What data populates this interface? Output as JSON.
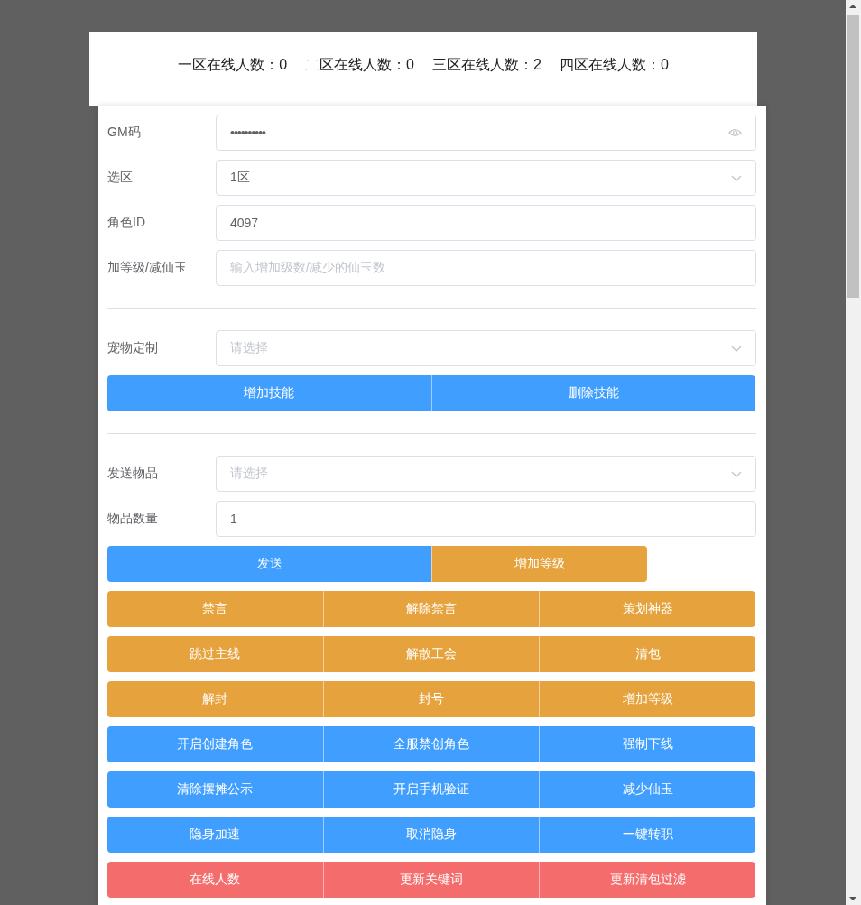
{
  "online_counts": [
    "一区在线人数：0",
    "二区在线人数：0",
    "三区在线人数：2",
    "四区在线人数：0"
  ],
  "sections": [
    {
      "fields": [
        {
          "label": "GM码",
          "kind": "password",
          "value": "••••••••••"
        },
        {
          "label": "选区",
          "kind": "select",
          "value": "1区"
        },
        {
          "label": "角色ID",
          "kind": "text",
          "value": "4097"
        },
        {
          "label": "加等级/减仙玉",
          "kind": "text",
          "placeholder": "输入增加级数/减少的仙玉数"
        }
      ]
    },
    {
      "fields": [
        {
          "label": "宠物定制",
          "kind": "select",
          "placeholder": "请选择"
        }
      ],
      "button_groups": [
        {
          "kind": "even",
          "buttons": [
            {
              "label": "增加技能",
              "color": "#409eff"
            },
            {
              "label": "删除技能",
              "color": "#409eff"
            }
          ]
        }
      ]
    },
    {
      "fields": [
        {
          "label": "发送物品",
          "kind": "select",
          "placeholder": "请选择"
        },
        {
          "label": "物品数量",
          "kind": "text",
          "value": "1"
        }
      ],
      "button_groups": [
        {
          "kind": "split",
          "buttons": [
            {
              "label": "发送",
              "color": "#409eff"
            },
            {
              "label": "增加等级",
              "color": "#e6a23c"
            }
          ]
        },
        {
          "kind": "even",
          "buttons": [
            {
              "label": "禁言",
              "color": "#e6a23c"
            },
            {
              "label": "解除禁言",
              "color": "#e6a23c"
            },
            {
              "label": "策划神器",
              "color": "#e6a23c"
            }
          ]
        },
        {
          "kind": "even",
          "buttons": [
            {
              "label": "跳过主线",
              "color": "#e6a23c"
            },
            {
              "label": "解散工会",
              "color": "#e6a23c"
            },
            {
              "label": "清包",
              "color": "#e6a23c"
            }
          ]
        },
        {
          "kind": "even",
          "buttons": [
            {
              "label": "解封",
              "color": "#e6a23c"
            },
            {
              "label": "封号",
              "color": "#e6a23c"
            },
            {
              "label": "增加等级",
              "color": "#e6a23c"
            }
          ]
        },
        {
          "kind": "even",
          "buttons": [
            {
              "label": "开启创建角色",
              "color": "#409eff"
            },
            {
              "label": "全服禁创角色",
              "color": "#409eff"
            },
            {
              "label": "强制下线",
              "color": "#409eff"
            }
          ]
        },
        {
          "kind": "even",
          "buttons": [
            {
              "label": "清除摆摊公示",
              "color": "#409eff"
            },
            {
              "label": "开启手机验证",
              "color": "#409eff"
            },
            {
              "label": "减少仙玉",
              "color": "#409eff"
            }
          ]
        },
        {
          "kind": "even",
          "buttons": [
            {
              "label": "隐身加速",
              "color": "#409eff"
            },
            {
              "label": "取消隐身",
              "color": "#409eff"
            },
            {
              "label": "一键转职",
              "color": "#409eff"
            }
          ]
        },
        {
          "kind": "even",
          "buttons": [
            {
              "label": "在线人数",
              "color": "#f56c6c"
            },
            {
              "label": "更新关键词",
              "color": "#f56c6c"
            },
            {
              "label": "更新清包过滤",
              "color": "#f56c6c"
            }
          ]
        }
      ]
    }
  ]
}
